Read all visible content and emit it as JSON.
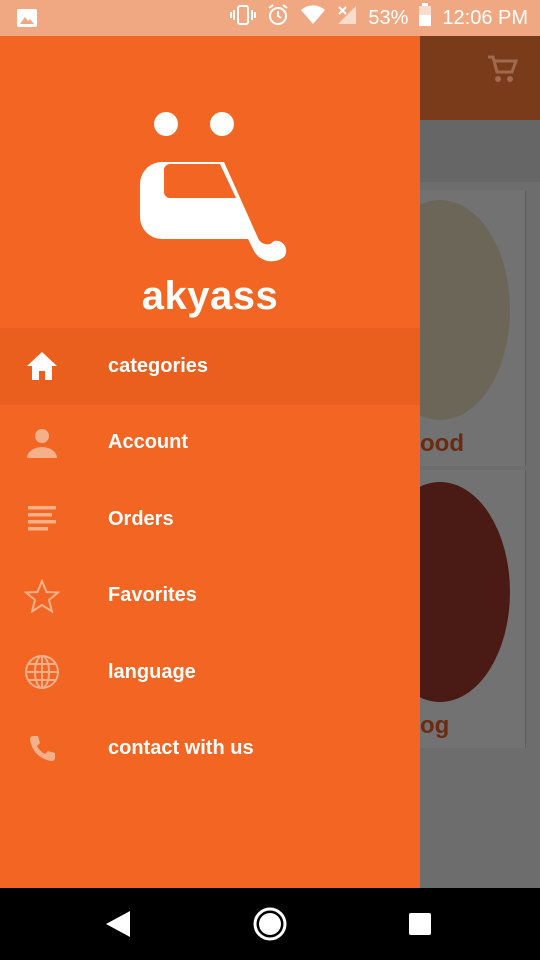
{
  "status_bar": {
    "battery": "53%",
    "time": "12:06 PM",
    "icons": [
      "image-icon",
      "vibrate-icon",
      "alarm-icon",
      "wifi-icon",
      "signal-icon",
      "battery-icon"
    ]
  },
  "drawer": {
    "brand_name": "akyass",
    "menu": [
      {
        "label": "categories",
        "icon": "home-icon",
        "active": true
      },
      {
        "label": "Account",
        "icon": "person-icon",
        "active": false
      },
      {
        "label": "Orders",
        "icon": "list-icon",
        "active": false
      },
      {
        "label": "Favorites",
        "icon": "star-icon",
        "active": false
      },
      {
        "label": "language",
        "icon": "globe-icon",
        "active": false
      },
      {
        "label": "contact with us",
        "icon": "phone-icon",
        "active": false
      }
    ]
  },
  "background_app": {
    "card1_label": "ood",
    "card2_label": "og"
  },
  "colors": {
    "primary": "#f26522",
    "active_item": "#eb5f1e",
    "status_bar": "#f0a882"
  }
}
